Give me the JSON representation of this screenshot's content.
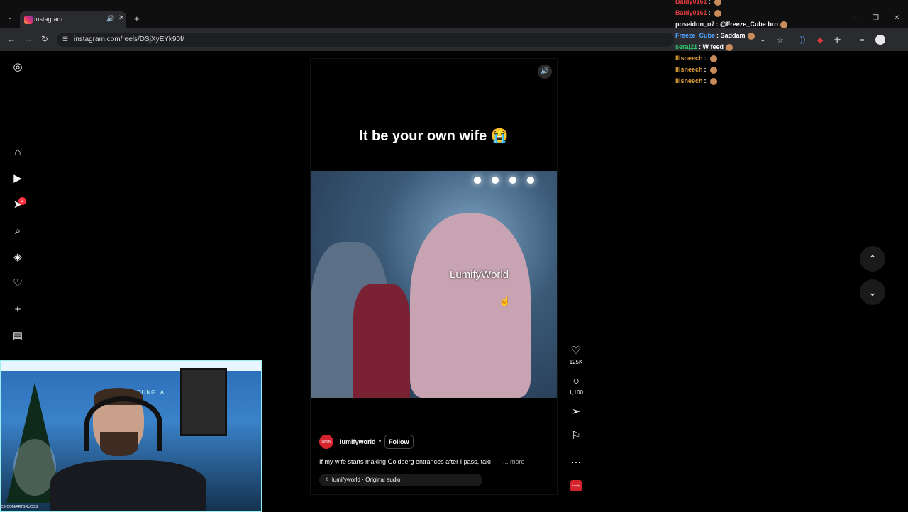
{
  "browser": {
    "tab_title": "Instagram",
    "url": "instagram.com/reels/DSjXyEYk90f/",
    "new_tab": "+",
    "close": "✕"
  },
  "chat": [
    {
      "name": "Baldy0161",
      "sep": ":",
      "message": "",
      "name_color": "#e03b3b"
    },
    {
      "name": "Baldy0161",
      "sep": ":",
      "message": "",
      "name_color": "#e03b3b"
    },
    {
      "name": "poseidon_o7",
      "sep": ":",
      "message": "@Freeze_Cube bro",
      "name_color": "#e6e6e6"
    },
    {
      "name": "Freeze_Cube",
      "sep": ":",
      "message": "Saddam",
      "name_color": "#4fa3ff"
    },
    {
      "name": "seraj21",
      "sep": ":",
      "message": "W feed",
      "name_color": "#2ecc71"
    },
    {
      "name": "lllsneech",
      "sep": ":",
      "message": "",
      "name_color": "#e6a23c"
    },
    {
      "name": "lllsneech",
      "sep": ":",
      "message": "",
      "name_color": "#e6a23c"
    },
    {
      "name": "lllsneech",
      "sep": ":",
      "message": "",
      "name_color": "#e6a23c"
    }
  ],
  "reel": {
    "caption": "It be your own wife 😭",
    "watermark": "LumifyWorld",
    "author": "lumifyworld",
    "follow": "Follow",
    "description": "If my wife starts making Goldberg entrances after I pass, takı",
    "more": "... more",
    "audio": "lumifyworld · Original audio",
    "avatar_text": "lumify"
  },
  "actions": {
    "likes": "125K",
    "comments": "1,100"
  },
  "nav": {
    "notification_count": "2"
  },
  "webcam": {
    "wall_logo": "YOUNGLA",
    "footer": "CE.COM/ARTSRUOSS"
  },
  "colors": {
    "accent_red": "#ff3040",
    "brand_red": "#d6242f",
    "background": "#000000"
  }
}
